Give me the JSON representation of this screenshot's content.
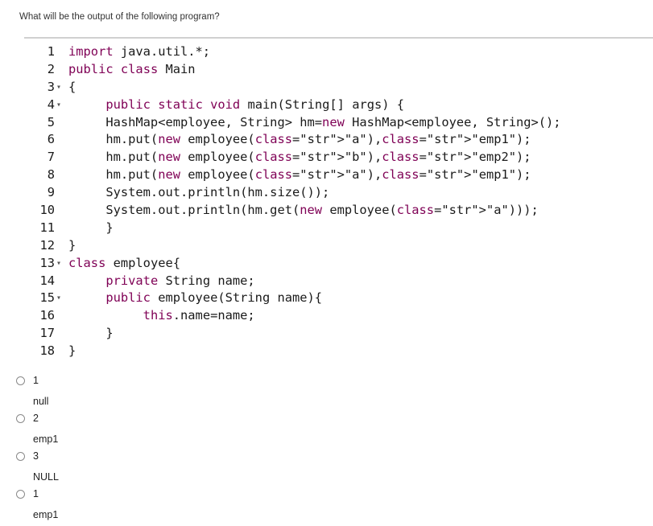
{
  "question": "What will be the output of the following program?",
  "code": {
    "lines": [
      {
        "num": "1",
        "fold": "",
        "text": "import java.util.*;"
      },
      {
        "num": "2",
        "fold": "",
        "text": "public class Main"
      },
      {
        "num": "3",
        "fold": "▾",
        "text": "{"
      },
      {
        "num": "4",
        "fold": "▾",
        "text": "     public static void main(String[] args) {"
      },
      {
        "num": "5",
        "fold": "",
        "text": "     HashMap<employee, String> hm=new HashMap<employee, String>();"
      },
      {
        "num": "6",
        "fold": "",
        "text": "     hm.put(new employee(\"a\"),\"emp1\");"
      },
      {
        "num": "7",
        "fold": "",
        "text": "     hm.put(new employee(\"b\"),\"emp2\");"
      },
      {
        "num": "8",
        "fold": "",
        "text": "     hm.put(new employee(\"a\"),\"emp1\");"
      },
      {
        "num": "9",
        "fold": "",
        "text": "     System.out.println(hm.size());"
      },
      {
        "num": "10",
        "fold": "",
        "text": "     System.out.println(hm.get(new employee(\"a\")));"
      },
      {
        "num": "11",
        "fold": "",
        "text": "     }"
      },
      {
        "num": "12",
        "fold": "",
        "text": "}"
      },
      {
        "num": "13",
        "fold": "▾",
        "text": "class employee{"
      },
      {
        "num": "14",
        "fold": "",
        "text": "     private String name;"
      },
      {
        "num": "15",
        "fold": "▾",
        "text": "     public employee(String name){"
      },
      {
        "num": "16",
        "fold": "",
        "text": "          this.name=name;"
      },
      {
        "num": "17",
        "fold": "",
        "text": "     }"
      },
      {
        "num": "18",
        "fold": "",
        "text": "}"
      }
    ]
  },
  "options": [
    {
      "line1": "1",
      "line2": "null"
    },
    {
      "line1": "2",
      "line2": "emp1"
    },
    {
      "line1": "3",
      "line2": "NULL"
    },
    {
      "line1": "1",
      "line2": "emp1"
    }
  ],
  "colors": {
    "keyword": "#7f0055",
    "string": "#2a00ff"
  }
}
